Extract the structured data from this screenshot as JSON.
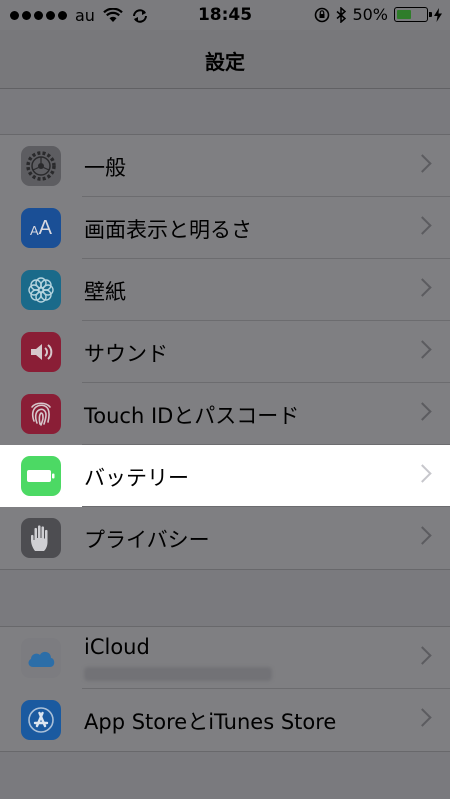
{
  "status_bar": {
    "carrier": "au",
    "time": "18:45",
    "battery_percent": "50%",
    "battery_level": 0.5
  },
  "nav": {
    "title": "設定"
  },
  "group1": [
    {
      "label": "一般",
      "icon": "gear-icon",
      "color": "#5d5d61"
    },
    {
      "label": "画面表示と明るさ",
      "icon": "text-size-icon",
      "color": "#1a4f96"
    },
    {
      "label": "壁紙",
      "icon": "flower-icon",
      "color": "#1a6a8a"
    },
    {
      "label": "サウンド",
      "icon": "speaker-icon",
      "color": "#8a1e36"
    },
    {
      "label": "Touch IDとパスコード",
      "icon": "fingerprint-icon",
      "color": "#8a1e36"
    },
    {
      "label": "バッテリー",
      "icon": "battery-icon",
      "color": "#4cd964",
      "highlighted": true
    },
    {
      "label": "プライバシー",
      "icon": "hand-icon",
      "color": "#4d4d51"
    }
  ],
  "group2": [
    {
      "label": "iCloud",
      "icon": "cloud-icon",
      "color": "#7c7c80"
    },
    {
      "label": "App StoreとiTunes Store",
      "icon": "appstore-icon",
      "color": "#1a5aa0"
    }
  ],
  "colors": {
    "dimmed_bg": "#7f7f82",
    "highlight": "#ffffff",
    "battery_green": "#4cd964"
  }
}
